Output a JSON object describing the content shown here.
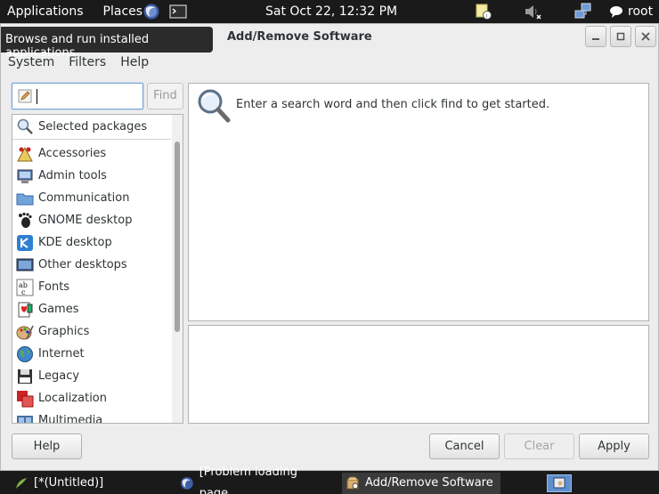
{
  "top_panel": {
    "applications": "Applications",
    "places": "Places",
    "clock": "Sat Oct 22, 12:32 PM",
    "user": "root",
    "icons": [
      "firefox-icon",
      "terminal-icon",
      "update-notifier-icon",
      "volume-muted-icon",
      "network-icon",
      "chat-icon"
    ]
  },
  "window": {
    "title": "Add/Remove Software",
    "tooltip": "Browse and run installed applications",
    "menu": [
      "System",
      "Filters",
      "Help"
    ],
    "search": {
      "value": "",
      "find_label": "Find"
    },
    "selected_packages": "Selected packages",
    "groups": [
      {
        "label": "Accessories",
        "icon": "accessories-icon"
      },
      {
        "label": "Admin tools",
        "icon": "admin-tools-icon"
      },
      {
        "label": "Communication",
        "icon": "communication-icon"
      },
      {
        "label": "GNOME desktop",
        "icon": "gnome-icon"
      },
      {
        "label": "KDE desktop",
        "icon": "kde-icon"
      },
      {
        "label": "Other desktops",
        "icon": "desktop-icon"
      },
      {
        "label": "Fonts",
        "icon": "fonts-icon"
      },
      {
        "label": "Games",
        "icon": "games-icon"
      },
      {
        "label": "Graphics",
        "icon": "graphics-icon"
      },
      {
        "label": "Internet",
        "icon": "internet-icon"
      },
      {
        "label": "Legacy",
        "icon": "legacy-icon"
      },
      {
        "label": "Localization",
        "icon": "localization-icon"
      },
      {
        "label": "Multimedia",
        "icon": "multimedia-icon"
      }
    ],
    "hint": "Enter a search word and then click find to get started.",
    "buttons": {
      "help": "Help",
      "cancel": "Cancel",
      "clear": "Clear",
      "apply": "Apply"
    }
  },
  "taskbar": {
    "tasks": [
      {
        "label": "[*(Untitled)]",
        "icon": "editor-icon"
      },
      {
        "label": "[Problem loading page...",
        "icon": "firefox-icon"
      },
      {
        "label": "Add/Remove Software",
        "icon": "package-icon"
      }
    ]
  }
}
